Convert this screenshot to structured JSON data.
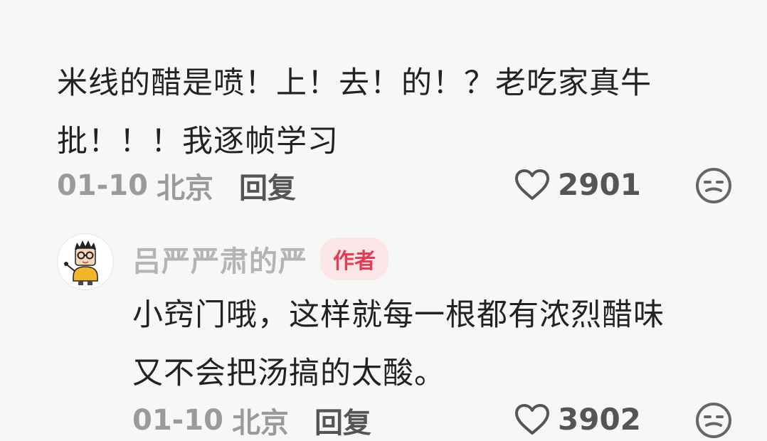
{
  "comments": [
    {
      "text_line_1": "米线的醋是喷！上！去！的！？老吃家真牛",
      "text_line_2": "批！！！我逐帧学习",
      "date": "01-10",
      "location": "北京",
      "reply_label": "回复",
      "likes": "2901",
      "like_icon": "heart-outline-icon",
      "dislike_icon": "meh-face-icon"
    },
    {
      "author_name": "吕严严肃的严",
      "author_badge": "作者",
      "avatar_icon": "cartoon-avatar",
      "text_line_1": "小窍门哦，这样就每一根都有浓烈醋味",
      "text_line_2": "又不会把汤搞的太酸。",
      "date": "01-10",
      "location": "北京",
      "reply_label": "回复",
      "likes": "3902",
      "like_icon": "heart-outline-icon",
      "dislike_icon": "meh-face-icon"
    }
  ],
  "colors": {
    "background": "#f7f7f7",
    "text_primary": "#222222",
    "text_secondary": "#9a9a9a",
    "author_badge_bg": "#fbe6e8",
    "author_badge_text": "#ea3b52"
  }
}
